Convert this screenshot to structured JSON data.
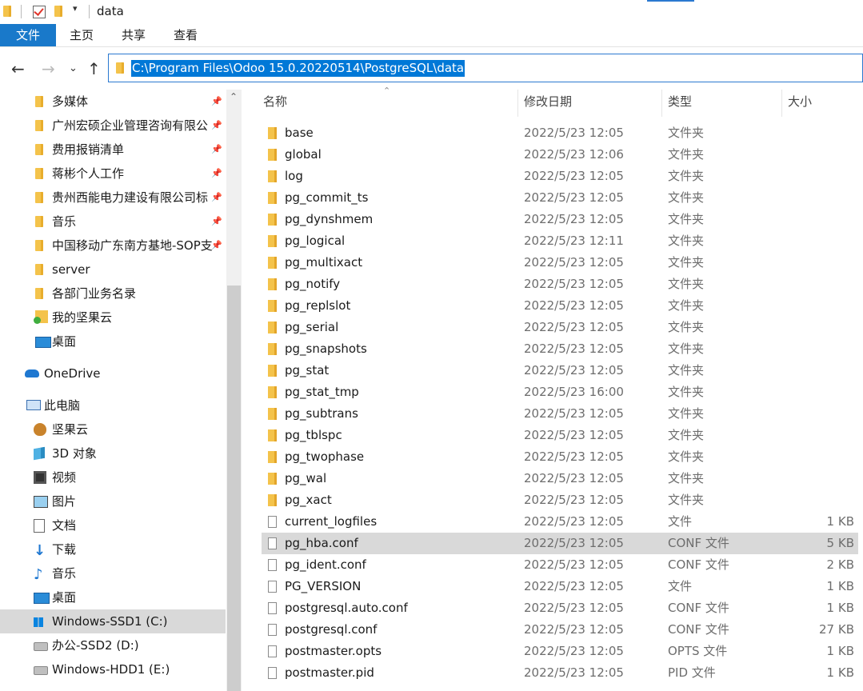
{
  "window": {
    "title": "data"
  },
  "ribbon": {
    "tabs": [
      "文件",
      "主页",
      "共享",
      "查看"
    ]
  },
  "address": {
    "path": "C:\\Program Files\\Odoo 15.0.20220514\\PostgreSQL\\data"
  },
  "nav": {
    "quick_access": [
      {
        "label": "多媒体",
        "pinned": true,
        "icon": "folder-icon"
      },
      {
        "label": "广州宏硕企业管理咨询有限公",
        "pinned": true,
        "icon": "folder-icon"
      },
      {
        "label": "费用报销清单",
        "pinned": true,
        "icon": "folder-icon"
      },
      {
        "label": "蒋彬个人工作",
        "pinned": true,
        "icon": "folder-icon"
      },
      {
        "label": "贵州西能电力建设有限公司标",
        "pinned": true,
        "icon": "folder-icon"
      },
      {
        "label": "音乐",
        "pinned": true,
        "icon": "folder-icon"
      },
      {
        "label": "中国移动广东南方基地-SOP支",
        "pinned": true,
        "icon": "folder-icon"
      },
      {
        "label": "server",
        "pinned": false,
        "icon": "folder-icon"
      },
      {
        "label": "各部门业务名录",
        "pinned": false,
        "icon": "folder-icon"
      },
      {
        "label": "我的坚果云",
        "pinned": false,
        "icon": "nutstore-sync-folder-icon"
      },
      {
        "label": "桌面",
        "pinned": false,
        "icon": "desktop-icon"
      }
    ],
    "onedrive": "OneDrive",
    "this_pc": "此电脑",
    "pc_items": [
      {
        "label": "坚果云",
        "icon": "nutstore-icon"
      },
      {
        "label": "3D 对象",
        "icon": "3d-objects-icon"
      },
      {
        "label": "视频",
        "icon": "video-icon"
      },
      {
        "label": "图片",
        "icon": "pictures-icon"
      },
      {
        "label": "文档",
        "icon": "documents-icon"
      },
      {
        "label": "下载",
        "icon": "download-icon"
      },
      {
        "label": "音乐",
        "icon": "music-icon"
      },
      {
        "label": "桌面",
        "icon": "desktop-icon"
      },
      {
        "label": "Windows-SSD1 (C:)",
        "icon": "windows-drive-icon"
      },
      {
        "label": "办公-SSD2 (D:)",
        "icon": "drive-icon"
      },
      {
        "label": "Windows-HDD1 (E:)",
        "icon": "drive-icon"
      }
    ]
  },
  "list": {
    "columns": [
      "名称",
      "修改日期",
      "类型",
      "大小"
    ],
    "rows": [
      {
        "name": "base",
        "date": "2022/5/23 12:05",
        "type": "文件夹",
        "size": "",
        "kind": "folder"
      },
      {
        "name": "global",
        "date": "2022/5/23 12:06",
        "type": "文件夹",
        "size": "",
        "kind": "folder"
      },
      {
        "name": "log",
        "date": "2022/5/23 12:05",
        "type": "文件夹",
        "size": "",
        "kind": "folder"
      },
      {
        "name": "pg_commit_ts",
        "date": "2022/5/23 12:05",
        "type": "文件夹",
        "size": "",
        "kind": "folder"
      },
      {
        "name": "pg_dynshmem",
        "date": "2022/5/23 12:05",
        "type": "文件夹",
        "size": "",
        "kind": "folder"
      },
      {
        "name": "pg_logical",
        "date": "2022/5/23 12:11",
        "type": "文件夹",
        "size": "",
        "kind": "folder"
      },
      {
        "name": "pg_multixact",
        "date": "2022/5/23 12:05",
        "type": "文件夹",
        "size": "",
        "kind": "folder"
      },
      {
        "name": "pg_notify",
        "date": "2022/5/23 12:05",
        "type": "文件夹",
        "size": "",
        "kind": "folder"
      },
      {
        "name": "pg_replslot",
        "date": "2022/5/23 12:05",
        "type": "文件夹",
        "size": "",
        "kind": "folder"
      },
      {
        "name": "pg_serial",
        "date": "2022/5/23 12:05",
        "type": "文件夹",
        "size": "",
        "kind": "folder"
      },
      {
        "name": "pg_snapshots",
        "date": "2022/5/23 12:05",
        "type": "文件夹",
        "size": "",
        "kind": "folder"
      },
      {
        "name": "pg_stat",
        "date": "2022/5/23 12:05",
        "type": "文件夹",
        "size": "",
        "kind": "folder"
      },
      {
        "name": "pg_stat_tmp",
        "date": "2022/5/23 16:00",
        "type": "文件夹",
        "size": "",
        "kind": "folder"
      },
      {
        "name": "pg_subtrans",
        "date": "2022/5/23 12:05",
        "type": "文件夹",
        "size": "",
        "kind": "folder"
      },
      {
        "name": "pg_tblspc",
        "date": "2022/5/23 12:05",
        "type": "文件夹",
        "size": "",
        "kind": "folder"
      },
      {
        "name": "pg_twophase",
        "date": "2022/5/23 12:05",
        "type": "文件夹",
        "size": "",
        "kind": "folder"
      },
      {
        "name": "pg_wal",
        "date": "2022/5/23 12:05",
        "type": "文件夹",
        "size": "",
        "kind": "folder"
      },
      {
        "name": "pg_xact",
        "date": "2022/5/23 12:05",
        "type": "文件夹",
        "size": "",
        "kind": "folder"
      },
      {
        "name": "current_logfiles",
        "date": "2022/5/23 12:05",
        "type": "文件",
        "size": "1 KB",
        "kind": "file"
      },
      {
        "name": "pg_hba.conf",
        "date": "2022/5/23 12:05",
        "type": "CONF 文件",
        "size": "5 KB",
        "kind": "file",
        "selected": true
      },
      {
        "name": "pg_ident.conf",
        "date": "2022/5/23 12:05",
        "type": "CONF 文件",
        "size": "2 KB",
        "kind": "file"
      },
      {
        "name": "PG_VERSION",
        "date": "2022/5/23 12:05",
        "type": "文件",
        "size": "1 KB",
        "kind": "file"
      },
      {
        "name": "postgresql.auto.conf",
        "date": "2022/5/23 12:05",
        "type": "CONF 文件",
        "size": "1 KB",
        "kind": "file"
      },
      {
        "name": "postgresql.conf",
        "date": "2022/5/23 12:05",
        "type": "CONF 文件",
        "size": "27 KB",
        "kind": "file"
      },
      {
        "name": "postmaster.opts",
        "date": "2022/5/23 12:05",
        "type": "OPTS 文件",
        "size": "1 KB",
        "kind": "file"
      },
      {
        "name": "postmaster.pid",
        "date": "2022/5/23 12:05",
        "type": "PID 文件",
        "size": "1 KB",
        "kind": "file"
      }
    ]
  },
  "colors": {
    "accent": "#1979ca",
    "selection": "#d9d9d9",
    "folder": "#f4c34b"
  }
}
